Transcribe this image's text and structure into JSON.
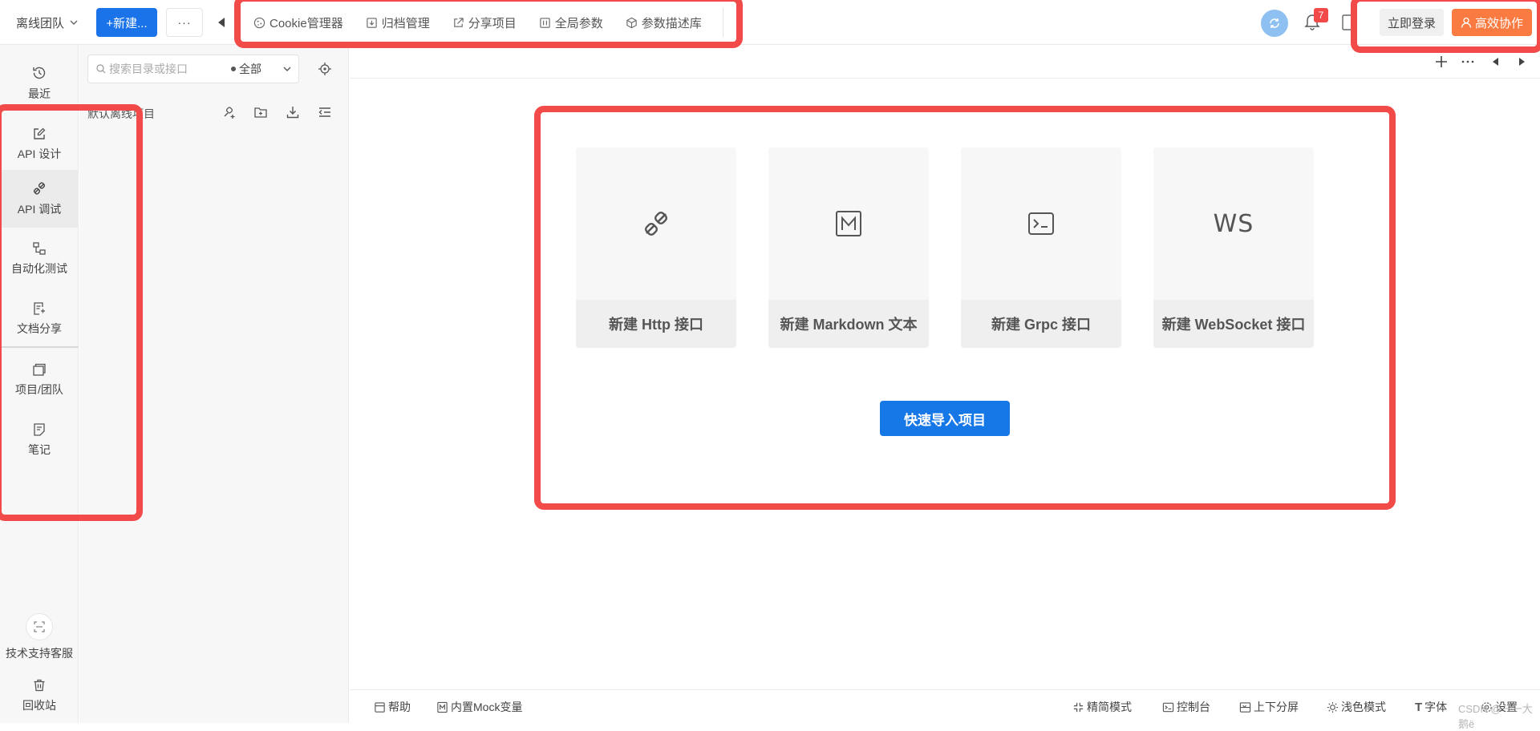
{
  "topbar": {
    "team_name": "离线团队",
    "new_button": "+新建...",
    "more_button": "···",
    "tools": [
      {
        "icon": "cookie-icon",
        "label": "Cookie管理器"
      },
      {
        "icon": "archive-icon",
        "label": "归档管理"
      },
      {
        "icon": "share-icon",
        "label": "分享项目"
      },
      {
        "icon": "params-icon",
        "label": "全局参数"
      },
      {
        "icon": "cube-icon",
        "label": "参数描述库"
      }
    ],
    "notification_count": "7",
    "login_button": "立即登录",
    "collab_button": "高效协作"
  },
  "sidebar": {
    "items": [
      {
        "icon": "history-icon",
        "label": "最近"
      },
      {
        "icon": "edit-icon",
        "label": "API 设计"
      },
      {
        "icon": "plug-icon",
        "label": "API 调试",
        "active": true
      },
      {
        "icon": "flow-icon",
        "label": "自动化测试"
      },
      {
        "icon": "doc-share-icon",
        "label": "文档分享"
      },
      {
        "icon": "project-icon",
        "label": "项目/团队"
      },
      {
        "icon": "note-icon",
        "label": "笔记"
      }
    ],
    "support_label": "技术支持客服",
    "trash_label": "回收站"
  },
  "tree": {
    "search_placeholder": "搜索目录或接口",
    "filter_value": "全部",
    "project_title": "默认离线项目"
  },
  "main": {
    "cards": [
      {
        "icon": "plug-icon",
        "label": "新建 Http 接口"
      },
      {
        "icon": "markdown-icon",
        "label": "新建 Markdown 文本"
      },
      {
        "icon": "terminal-icon",
        "label": "新建 Grpc 接口"
      },
      {
        "icon": "websocket-icon",
        "label": "新建 WebSocket 接口",
        "icon_text": "WS"
      }
    ],
    "import_button": "快速导入项目"
  },
  "statusbar": {
    "help": "帮助",
    "mock": "内置Mock变量",
    "compact": "精简模式",
    "console": "控制台",
    "split": "上下分屏",
    "theme": "浅色模式",
    "font": "字体",
    "settings": "设置"
  },
  "watermark": "CSDN @一一大鹅ё"
}
